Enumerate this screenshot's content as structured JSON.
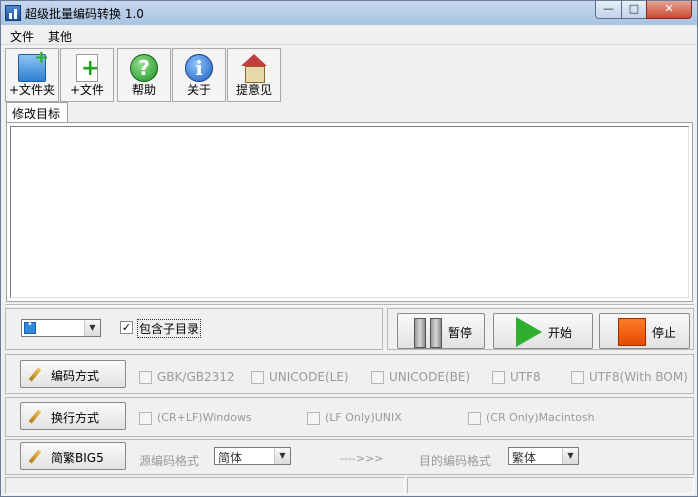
{
  "window": {
    "title": "超级批量编码转换 1.0"
  },
  "window_controls": {
    "minimize": "—",
    "maximize": "□",
    "close": "✕"
  },
  "menu": [
    {
      "label": "文件"
    },
    {
      "label": "其他"
    }
  ],
  "toolbar": [
    {
      "label": "+文件夹",
      "icon": "add-folder-icon"
    },
    {
      "label": "+文件",
      "icon": "add-file-icon"
    },
    {
      "label": "帮助",
      "icon": "help-icon",
      "glyph": "?"
    },
    {
      "label": "关于",
      "icon": "info-icon",
      "glyph": "i"
    },
    {
      "label": "提意见",
      "icon": "house-icon"
    }
  ],
  "tab": {
    "label": "修改目标"
  },
  "filter": {
    "include_subdirs_label": "包含子目录",
    "include_subdirs_checked": "✓"
  },
  "actions": {
    "pause": "暂停",
    "start": "开始",
    "stop": "停止"
  },
  "encoding": {
    "button": "编码方式",
    "options": [
      "GBK/GB2312",
      "UNICODE(LE)",
      "UNICODE(BE)",
      "UTF8",
      "UTF8(With BOM)"
    ]
  },
  "newline": {
    "button": "换行方式",
    "options": [
      "(CR+LF)Windows",
      "(LF Only)UNIX",
      "(CR Only)Macintosh"
    ]
  },
  "convert": {
    "button": "简繁BIG5",
    "source_label": "源编码格式",
    "source_value": "简体",
    "arrow": "---->>>",
    "target_label": "目的编码格式",
    "target_value": "繁体"
  },
  "colors": {
    "start_green": "#2fae2f",
    "stop_orange": "#e34a00",
    "title_bar": "#b8cfea"
  }
}
